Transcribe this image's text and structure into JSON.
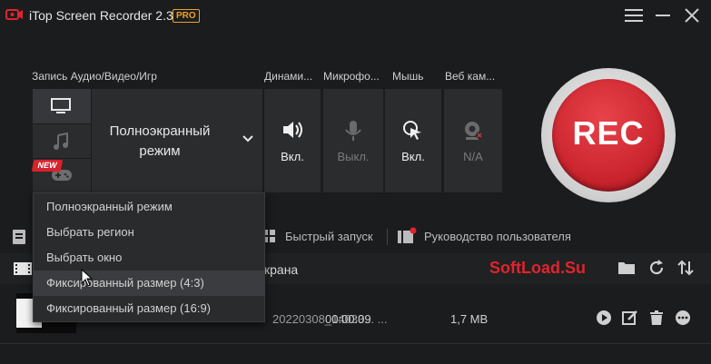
{
  "titlebar": {
    "title": "iTop Screen Recorder 2.3",
    "badge": "PRO"
  },
  "sections": {
    "record_label": "Запись Аудио/Видео/Игр",
    "speaker_label": "Динами...",
    "mic_label": "Микрофо...",
    "mouse_label": "Мышь",
    "webcam_label": "Веб кам..."
  },
  "mode": {
    "selected_line1": "Полноэкранный",
    "selected_line2": "режим",
    "new_badge": "NEW"
  },
  "toggles": {
    "speaker": "Вкл.",
    "mic": "Выкл.",
    "mouse": "Вкл.",
    "webcam": "N/A"
  },
  "rec_button": "REC",
  "toolbar": {
    "quick_launch": "Быстрый запуск",
    "user_guide": "Руководство пользователя"
  },
  "list": {
    "header_partial": "крана",
    "watermark": "SoftLoad.Su",
    "row": {
      "filename_partial": "20220308_14033... ...",
      "duration": "00:00:09",
      "size": "1,7 MB"
    }
  },
  "dropdown": {
    "items": [
      "Полноэкранный режим",
      "Выбрать регион",
      "Выбрать окно",
      "Фиксированный размер (4:3)",
      "Фиксированный размер (16:9)"
    ],
    "highlighted_index": 3
  },
  "colors": {
    "accent_red": "#cc2630",
    "watermark_red": "#e0242c",
    "pro_orange": "#f0a020",
    "background": "#1b1c1e",
    "panel": "#2b2c2e"
  },
  "icons": {
    "logo": "camera-logo-icon",
    "menu": "hamburger-menu-icon",
    "minimize": "minimize-icon",
    "close": "close-icon",
    "monitor": "monitor-icon",
    "music": "music-note-icon",
    "game": "gamepad-icon",
    "chevron": "chevron-down-icon",
    "speaker": "speaker-icon",
    "mic": "microphone-icon",
    "mouse": "mouse-click-icon",
    "webcam": "webcam-icon"
  }
}
